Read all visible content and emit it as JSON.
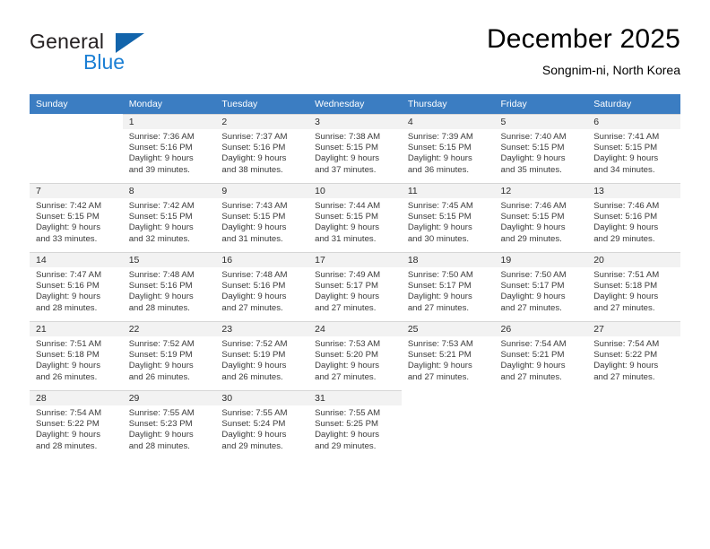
{
  "brand": {
    "line1": "General",
    "line2": "Blue",
    "logo_icon": "triangle-logo-icon"
  },
  "header": {
    "title": "December 2025",
    "subtitle": "Songnim-ni, North Korea"
  },
  "theme": {
    "header_blue": "#3b7dc2",
    "brand_blue": "#1b7fd4",
    "logo_blue": "#1264ab",
    "day_band": "#f2f2f2",
    "grid_line": "#d6d6d6"
  },
  "weekday_headers": [
    "Sunday",
    "Monday",
    "Tuesday",
    "Wednesday",
    "Thursday",
    "Friday",
    "Saturday"
  ],
  "weeks": [
    [
      {
        "day": "",
        "lines": []
      },
      {
        "day": "1",
        "lines": [
          "Sunrise: 7:36 AM",
          "Sunset: 5:16 PM",
          "Daylight: 9 hours",
          "and 39 minutes."
        ]
      },
      {
        "day": "2",
        "lines": [
          "Sunrise: 7:37 AM",
          "Sunset: 5:16 PM",
          "Daylight: 9 hours",
          "and 38 minutes."
        ]
      },
      {
        "day": "3",
        "lines": [
          "Sunrise: 7:38 AM",
          "Sunset: 5:15 PM",
          "Daylight: 9 hours",
          "and 37 minutes."
        ]
      },
      {
        "day": "4",
        "lines": [
          "Sunrise: 7:39 AM",
          "Sunset: 5:15 PM",
          "Daylight: 9 hours",
          "and 36 minutes."
        ]
      },
      {
        "day": "5",
        "lines": [
          "Sunrise: 7:40 AM",
          "Sunset: 5:15 PM",
          "Daylight: 9 hours",
          "and 35 minutes."
        ]
      },
      {
        "day": "6",
        "lines": [
          "Sunrise: 7:41 AM",
          "Sunset: 5:15 PM",
          "Daylight: 9 hours",
          "and 34 minutes."
        ]
      }
    ],
    [
      {
        "day": "7",
        "lines": [
          "Sunrise: 7:42 AM",
          "Sunset: 5:15 PM",
          "Daylight: 9 hours",
          "and 33 minutes."
        ]
      },
      {
        "day": "8",
        "lines": [
          "Sunrise: 7:42 AM",
          "Sunset: 5:15 PM",
          "Daylight: 9 hours",
          "and 32 minutes."
        ]
      },
      {
        "day": "9",
        "lines": [
          "Sunrise: 7:43 AM",
          "Sunset: 5:15 PM",
          "Daylight: 9 hours",
          "and 31 minutes."
        ]
      },
      {
        "day": "10",
        "lines": [
          "Sunrise: 7:44 AM",
          "Sunset: 5:15 PM",
          "Daylight: 9 hours",
          "and 31 minutes."
        ]
      },
      {
        "day": "11",
        "lines": [
          "Sunrise: 7:45 AM",
          "Sunset: 5:15 PM",
          "Daylight: 9 hours",
          "and 30 minutes."
        ]
      },
      {
        "day": "12",
        "lines": [
          "Sunrise: 7:46 AM",
          "Sunset: 5:15 PM",
          "Daylight: 9 hours",
          "and 29 minutes."
        ]
      },
      {
        "day": "13",
        "lines": [
          "Sunrise: 7:46 AM",
          "Sunset: 5:16 PM",
          "Daylight: 9 hours",
          "and 29 minutes."
        ]
      }
    ],
    [
      {
        "day": "14",
        "lines": [
          "Sunrise: 7:47 AM",
          "Sunset: 5:16 PM",
          "Daylight: 9 hours",
          "and 28 minutes."
        ]
      },
      {
        "day": "15",
        "lines": [
          "Sunrise: 7:48 AM",
          "Sunset: 5:16 PM",
          "Daylight: 9 hours",
          "and 28 minutes."
        ]
      },
      {
        "day": "16",
        "lines": [
          "Sunrise: 7:48 AM",
          "Sunset: 5:16 PM",
          "Daylight: 9 hours",
          "and 27 minutes."
        ]
      },
      {
        "day": "17",
        "lines": [
          "Sunrise: 7:49 AM",
          "Sunset: 5:17 PM",
          "Daylight: 9 hours",
          "and 27 minutes."
        ]
      },
      {
        "day": "18",
        "lines": [
          "Sunrise: 7:50 AM",
          "Sunset: 5:17 PM",
          "Daylight: 9 hours",
          "and 27 minutes."
        ]
      },
      {
        "day": "19",
        "lines": [
          "Sunrise: 7:50 AM",
          "Sunset: 5:17 PM",
          "Daylight: 9 hours",
          "and 27 minutes."
        ]
      },
      {
        "day": "20",
        "lines": [
          "Sunrise: 7:51 AM",
          "Sunset: 5:18 PM",
          "Daylight: 9 hours",
          "and 27 minutes."
        ]
      }
    ],
    [
      {
        "day": "21",
        "lines": [
          "Sunrise: 7:51 AM",
          "Sunset: 5:18 PM",
          "Daylight: 9 hours",
          "and 26 minutes."
        ]
      },
      {
        "day": "22",
        "lines": [
          "Sunrise: 7:52 AM",
          "Sunset: 5:19 PM",
          "Daylight: 9 hours",
          "and 26 minutes."
        ]
      },
      {
        "day": "23",
        "lines": [
          "Sunrise: 7:52 AM",
          "Sunset: 5:19 PM",
          "Daylight: 9 hours",
          "and 26 minutes."
        ]
      },
      {
        "day": "24",
        "lines": [
          "Sunrise: 7:53 AM",
          "Sunset: 5:20 PM",
          "Daylight: 9 hours",
          "and 27 minutes."
        ]
      },
      {
        "day": "25",
        "lines": [
          "Sunrise: 7:53 AM",
          "Sunset: 5:21 PM",
          "Daylight: 9 hours",
          "and 27 minutes."
        ]
      },
      {
        "day": "26",
        "lines": [
          "Sunrise: 7:54 AM",
          "Sunset: 5:21 PM",
          "Daylight: 9 hours",
          "and 27 minutes."
        ]
      },
      {
        "day": "27",
        "lines": [
          "Sunrise: 7:54 AM",
          "Sunset: 5:22 PM",
          "Daylight: 9 hours",
          "and 27 minutes."
        ]
      }
    ],
    [
      {
        "day": "28",
        "lines": [
          "Sunrise: 7:54 AM",
          "Sunset: 5:22 PM",
          "Daylight: 9 hours",
          "and 28 minutes."
        ]
      },
      {
        "day": "29",
        "lines": [
          "Sunrise: 7:55 AM",
          "Sunset: 5:23 PM",
          "Daylight: 9 hours",
          "and 28 minutes."
        ]
      },
      {
        "day": "30",
        "lines": [
          "Sunrise: 7:55 AM",
          "Sunset: 5:24 PM",
          "Daylight: 9 hours",
          "and 29 minutes."
        ]
      },
      {
        "day": "31",
        "lines": [
          "Sunrise: 7:55 AM",
          "Sunset: 5:25 PM",
          "Daylight: 9 hours",
          "and 29 minutes."
        ]
      },
      {
        "day": "",
        "lines": []
      },
      {
        "day": "",
        "lines": []
      },
      {
        "day": "",
        "lines": []
      }
    ]
  ]
}
